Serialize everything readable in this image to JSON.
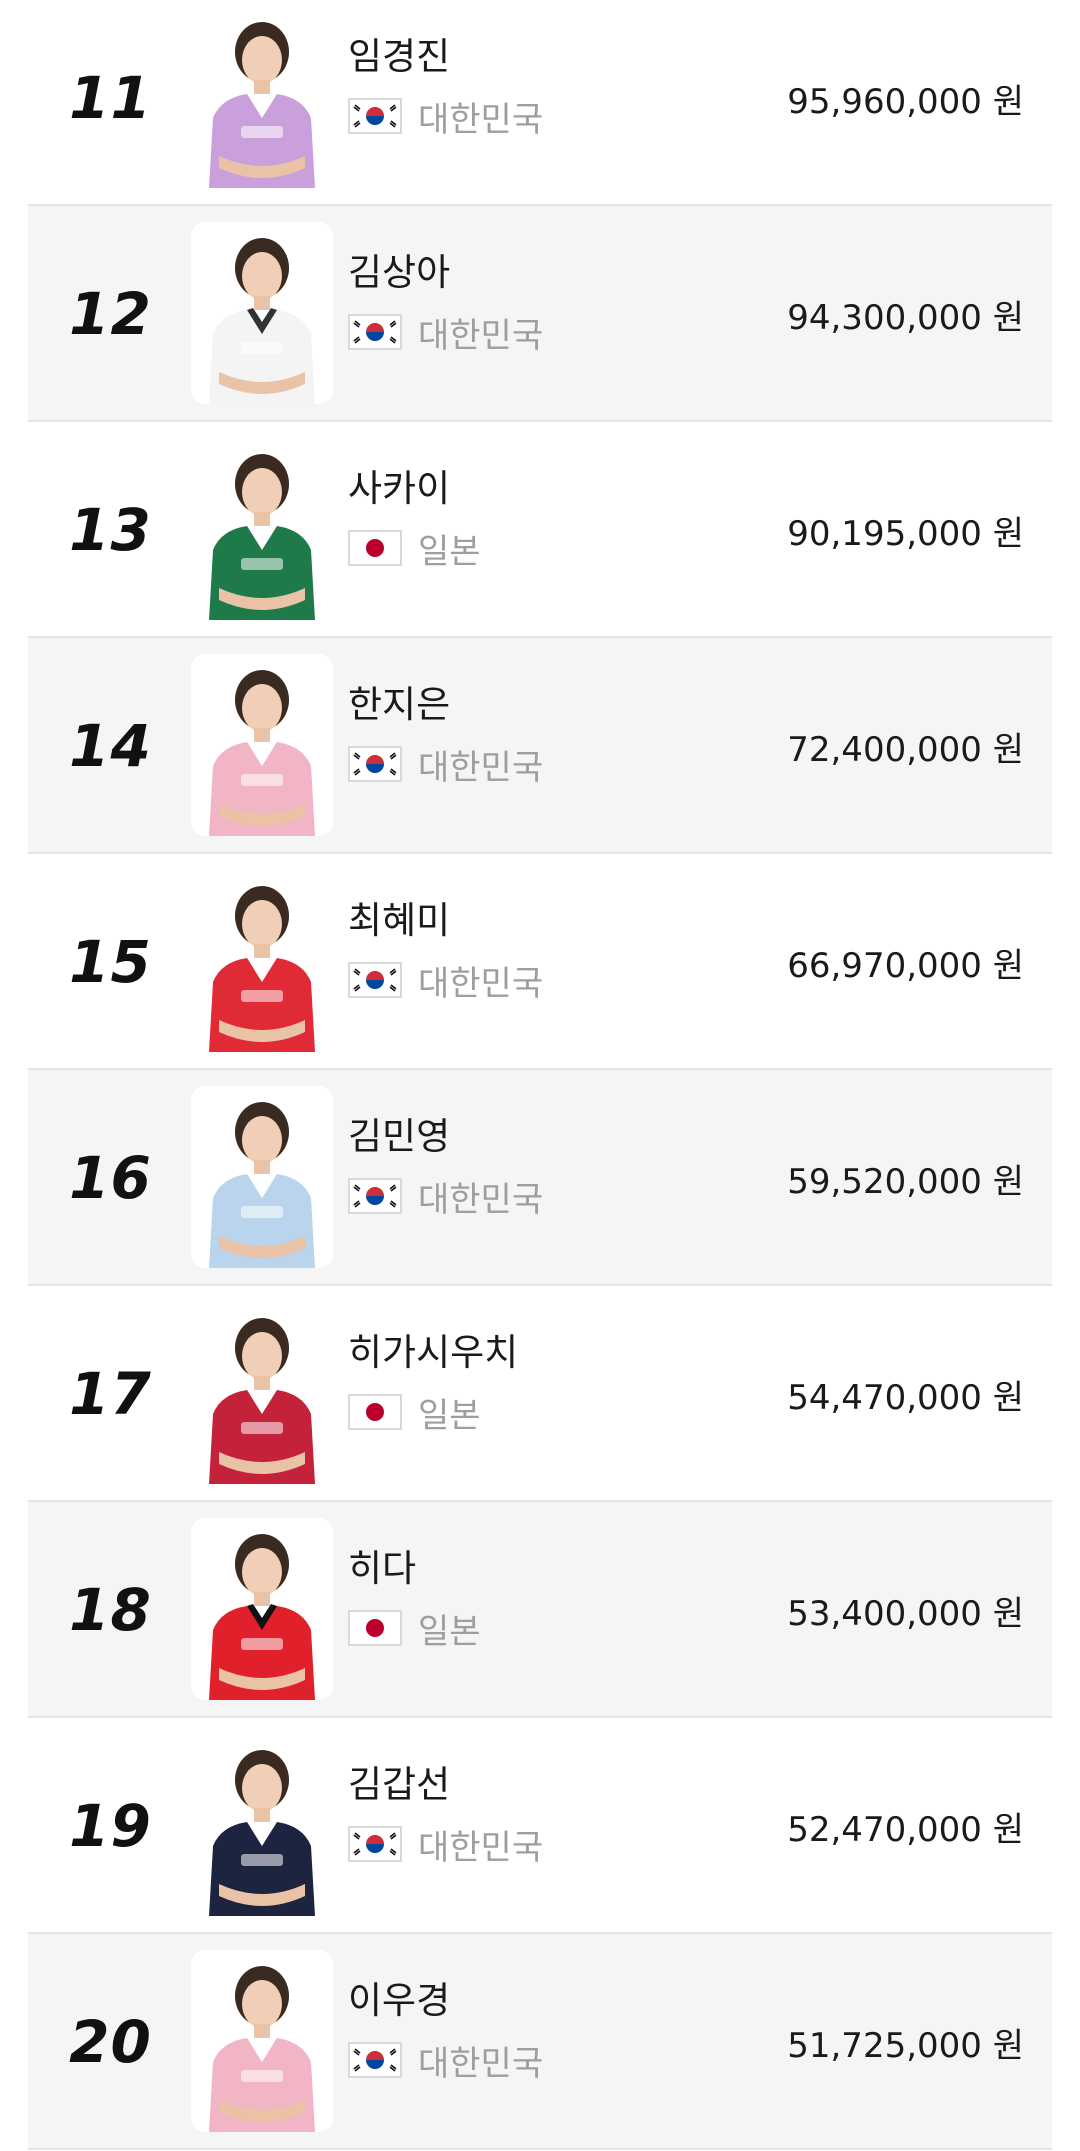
{
  "rows": [
    {
      "rank": "11",
      "name": "임경진",
      "country": "대한민국",
      "flag": "korea-flag-icon",
      "prize": "95,960,000 원",
      "shirt": "#c9a0dc",
      "collar": "#ffffff",
      "photo_bg": false
    },
    {
      "rank": "12",
      "name": "김상아",
      "country": "대한민국",
      "flag": "korea-flag-icon",
      "prize": "94,300,000 원",
      "shirt": "#f4f4f4",
      "collar": "#333333",
      "photo_bg": true
    },
    {
      "rank": "13",
      "name": "사카이",
      "country": "일본",
      "flag": "japan-flag-icon",
      "prize": "90,195,000 원",
      "shirt": "#1f7a4a",
      "collar": "#ffffff",
      "photo_bg": false
    },
    {
      "rank": "14",
      "name": "한지은",
      "country": "대한민국",
      "flag": "korea-flag-icon",
      "prize": "72,400,000 원",
      "shirt": "#f2b5c6",
      "collar": "#ffffff",
      "photo_bg": true
    },
    {
      "rank": "15",
      "name": "최혜미",
      "country": "대한민국",
      "flag": "korea-flag-icon",
      "prize": "66,970,000 원",
      "shirt": "#e02a35",
      "collar": "#ffffff",
      "photo_bg": false
    },
    {
      "rank": "16",
      "name": "김민영",
      "country": "대한민국",
      "flag": "korea-flag-icon",
      "prize": "59,520,000 원",
      "shirt": "#b9d4ec",
      "collar": "#ffffff",
      "photo_bg": true
    },
    {
      "rank": "17",
      "name": "히가시우치",
      "country": "일본",
      "flag": "japan-flag-icon",
      "prize": "54,470,000 원",
      "shirt": "#c4213a",
      "collar": "#ffffff",
      "photo_bg": false
    },
    {
      "rank": "18",
      "name": "히다",
      "country": "일본",
      "flag": "japan-flag-icon",
      "prize": "53,400,000 원",
      "shirt": "#e0202a",
      "collar": "#111111",
      "photo_bg": true
    },
    {
      "rank": "19",
      "name": "김갑선",
      "country": "대한민국",
      "flag": "korea-flag-icon",
      "prize": "52,470,000 원",
      "shirt": "#1c2440",
      "collar": "#ffffff",
      "photo_bg": false
    },
    {
      "rank": "20",
      "name": "이우경",
      "country": "대한민국",
      "flag": "korea-flag-icon",
      "prize": "51,725,000 원",
      "shirt": "#f2b5c6",
      "collar": "#ffffff",
      "photo_bg": true
    }
  ],
  "colors": {
    "row_alt_bg": "#f5f5f5",
    "divider": "#e3e3e3",
    "country_text": "#9e9e9e",
    "korea_red": "#cd2e3a",
    "korea_blue": "#0047a0",
    "japan_red": "#bc002d"
  }
}
